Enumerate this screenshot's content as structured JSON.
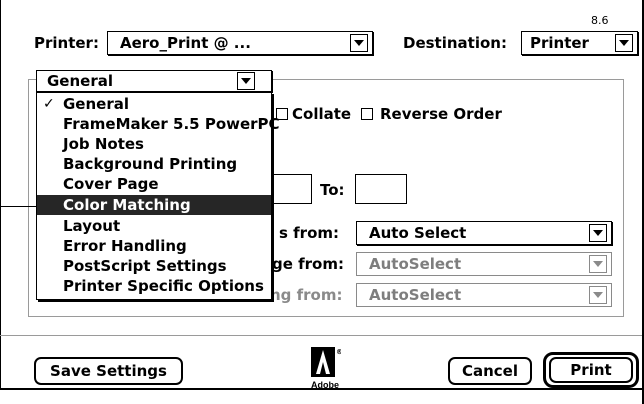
{
  "dialog": {
    "version": "8.6",
    "printer_label": "Printer:",
    "printer_value": "Aero_Print @ ...",
    "destination_label": "Destination:",
    "destination_value": "Printer"
  },
  "panel_popup": {
    "selected": "General",
    "menu_items": [
      {
        "label": "General",
        "checked": true
      },
      {
        "label": "FrameMaker 5.5 PowerPC"
      },
      {
        "label": "Job Notes"
      },
      {
        "label": "Background Printing"
      },
      {
        "label": "Cover Page"
      },
      {
        "label": "Color Matching",
        "highlighted": true
      },
      {
        "label": "Layout"
      },
      {
        "label": "Error Handling"
      },
      {
        "label": "PostScript Settings"
      },
      {
        "label": "Printer Specific Options"
      }
    ]
  },
  "general_panel": {
    "collate_label": "Collate",
    "reverse_order_label": "Reverse Order",
    "to_label": "To:",
    "from_value": "",
    "to_value": "",
    "paper_source_label_1": "s from:",
    "paper_source_label_2": "ge from:",
    "paper_source_label_3": "ng from:",
    "paper_source_value_1": "Auto Select",
    "paper_source_value_2": "AutoSelect",
    "paper_source_value_3": "AutoSelect"
  },
  "buttons": {
    "save_settings": "Save Settings",
    "cancel": "Cancel",
    "print": "Print"
  },
  "logo": {
    "brand": "Adobe",
    "mark": "®"
  },
  "icons": [
    "checkmark-icon",
    "chevron-down-icon",
    "adobe-logo-icon"
  ]
}
